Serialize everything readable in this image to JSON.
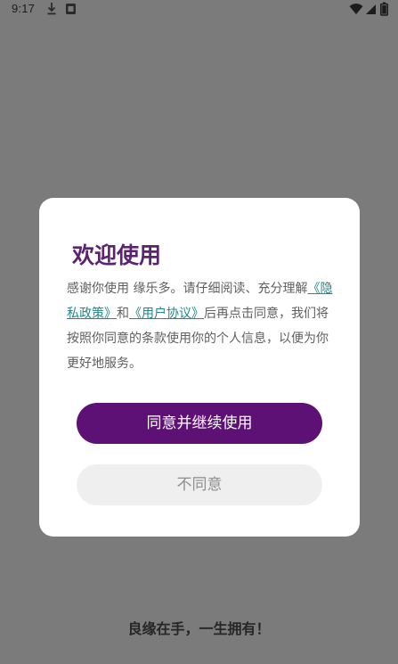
{
  "status_bar": {
    "time": "9:17",
    "icons": [
      "download-icon",
      "app-notification-icon",
      "wifi-icon",
      "signal-icon",
      "battery-icon"
    ]
  },
  "dialog": {
    "title": "欢迎使用",
    "body": {
      "intro": "感谢你使用 缘乐多。请仔细阅读、充分理解",
      "privacy_link": "《隐私政策》",
      "and": "和",
      "agreement_link": "《用户协议》",
      "outro": "后再点击同意，我们将按照你同意的条款使用你的个人信息，以便为你更好地服务。"
    },
    "agree_button": "同意并继续使用",
    "disagree_button": "不同意"
  },
  "slogan": "良缘在手，一生拥有！",
  "colors": {
    "overlay": "#7b7b7b",
    "title": "#5c2373",
    "link": "#23888a",
    "agree_bg": "#5e1174",
    "disagree_bg": "#efefef"
  }
}
